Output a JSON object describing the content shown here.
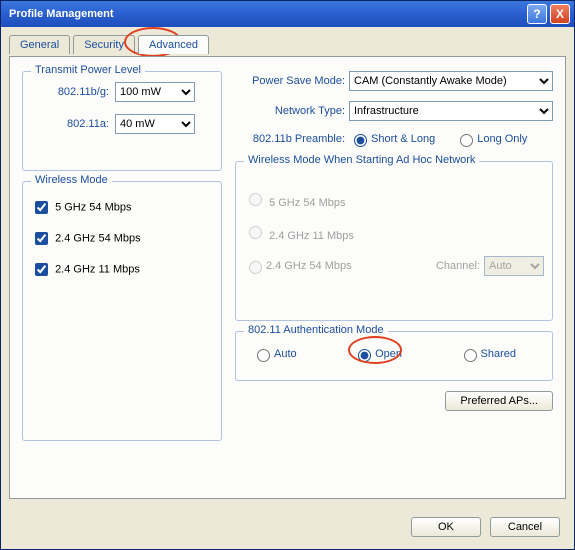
{
  "window": {
    "title": "Profile Management"
  },
  "tabs": {
    "general": "General",
    "security": "Security",
    "advanced": "Advanced"
  },
  "transmit": {
    "legend": "Transmit Power Level",
    "bg_label": "802.11b/g:",
    "bg_value": "100 mW",
    "a_label": "802.11a:",
    "a_value": "40 mW"
  },
  "wireless": {
    "legend": "Wireless Mode",
    "opt1": "5 GHz 54 Mbps",
    "opt2": "2.4 GHz 54 Mbps",
    "opt3": "2.4 GHz 11 Mbps"
  },
  "psm": {
    "label": "Power Save Mode:",
    "value": "CAM (Constantly Awake Mode)"
  },
  "nettype": {
    "label": "Network Type:",
    "value": "Infrastructure"
  },
  "preamble": {
    "label": "802.11b Preamble:",
    "short_long": "Short & Long",
    "long_only": "Long Only"
  },
  "adhoc": {
    "legend": "Wireless Mode When Starting Ad Hoc Network",
    "opt1": "5 GHz 54 Mbps",
    "opt2": "2.4 GHz 11 Mbps",
    "opt3": "2.4 GHz 54 Mbps",
    "channel_label": "Channel:",
    "channel_value": "Auto"
  },
  "auth": {
    "legend": "802.11 Authentication Mode",
    "auto": "Auto",
    "open": "Open",
    "shared": "Shared"
  },
  "buttons": {
    "preferred": "Preferred APs...",
    "ok": "OK",
    "cancel": "Cancel"
  }
}
